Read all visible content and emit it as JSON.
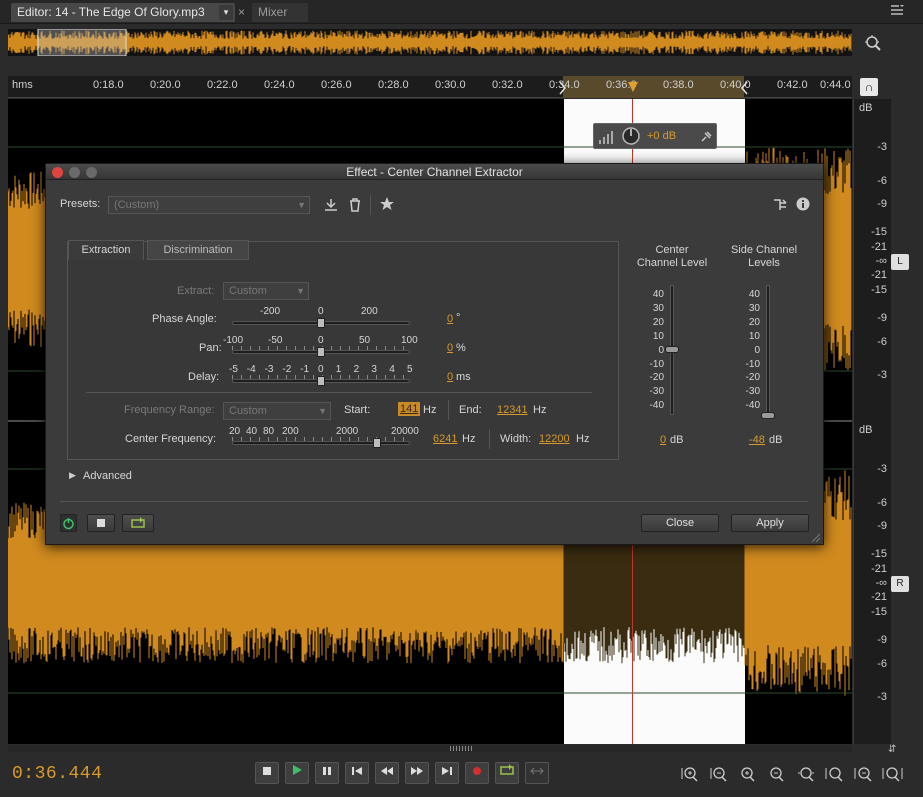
{
  "tabs": {
    "editor_label": "Editor: 14 - The Edge Of Glory.mp3",
    "mixer_label": "Mixer",
    "close_glyph": "×",
    "dropdown_glyph": "▾"
  },
  "ruler": {
    "units_label": "hms",
    "ticks": [
      "0:18.0",
      "0:20.0",
      "0:22.0",
      "0:24.0",
      "0:26.0",
      "0:28.0",
      "0:30.0",
      "0:32.0",
      "0:34.0",
      "0:36.0",
      "0:38.0",
      "0:40.0",
      "0:42.0",
      "0:44.0"
    ]
  },
  "db_scale": {
    "header": "dB",
    "left_labels": [
      "-3",
      "-6",
      "-9",
      "-15",
      "-21",
      "-∞",
      "-21",
      "-15",
      "-9",
      "-6",
      "-3"
    ],
    "right_labels": [
      "-3",
      "-6",
      "-9",
      "-15",
      "-21",
      "-∞",
      "-21",
      "-15",
      "-9",
      "-6",
      "-3"
    ],
    "left_channel": "L",
    "right_channel": "R"
  },
  "hud": {
    "volume_value": "+0 dB"
  },
  "dialog": {
    "title": "Effect - Center Channel Extractor",
    "presets_label": "Presets:",
    "presets_value": "(Custom)",
    "tabs": [
      "Extraction",
      "Discrimination"
    ],
    "extract_label": "Extract:",
    "extract_value": "Custom",
    "phase_angle": {
      "label": "Phase Angle:",
      "scale": [
        "-200",
        "0",
        "200"
      ],
      "value": "0",
      "unit": "°"
    },
    "pan": {
      "label": "Pan:",
      "scale": [
        "-100",
        "-50",
        "0",
        "50",
        "100"
      ],
      "value": "0",
      "unit": "%"
    },
    "delay": {
      "label": "Delay:",
      "scale": [
        "-5",
        "-4",
        "-3",
        "-2",
        "-1",
        "0",
        "1",
        "2",
        "3",
        "4",
        "5"
      ],
      "value": "0",
      "unit": "ms"
    },
    "frequency_range": {
      "label": "Frequency Range:",
      "value": "Custom",
      "start_label": "Start:",
      "start_value": "141",
      "start_unit": "Hz",
      "end_label": "End:",
      "end_value": "12341",
      "end_unit": "Hz"
    },
    "center_frequency": {
      "label": "Center Frequency:",
      "scale": [
        "20",
        "40",
        "80",
        "200",
        "2000",
        "20000"
      ],
      "value": "6241",
      "unit": "Hz",
      "width_label": "Width:",
      "width_value": "12200",
      "width_unit": "Hz"
    },
    "center_channel_level": {
      "label_line1": "Center",
      "label_line2": "Channel Level",
      "scale": [
        "40",
        "30",
        "20",
        "10",
        "0",
        "-10",
        "-20",
        "-30",
        "-40"
      ],
      "value": "0",
      "unit": "dB"
    },
    "side_channel_levels": {
      "label_line1": "Side Channel",
      "label_line2": "Levels",
      "scale": [
        "40",
        "30",
        "20",
        "10",
        "0",
        "-10",
        "-20",
        "-30",
        "-40"
      ],
      "value": "-48",
      "unit": "dB"
    },
    "advanced_label": "Advanced",
    "close_label": "Close",
    "apply_label": "Apply"
  },
  "transport": {
    "time": "0:36.444"
  },
  "colors": {
    "waveform": "#d08a1e",
    "time_display": "#d89a2b",
    "selection": "#fbfbfb",
    "value_text": "#d89a2b",
    "power_button": "#3fbf6a"
  }
}
